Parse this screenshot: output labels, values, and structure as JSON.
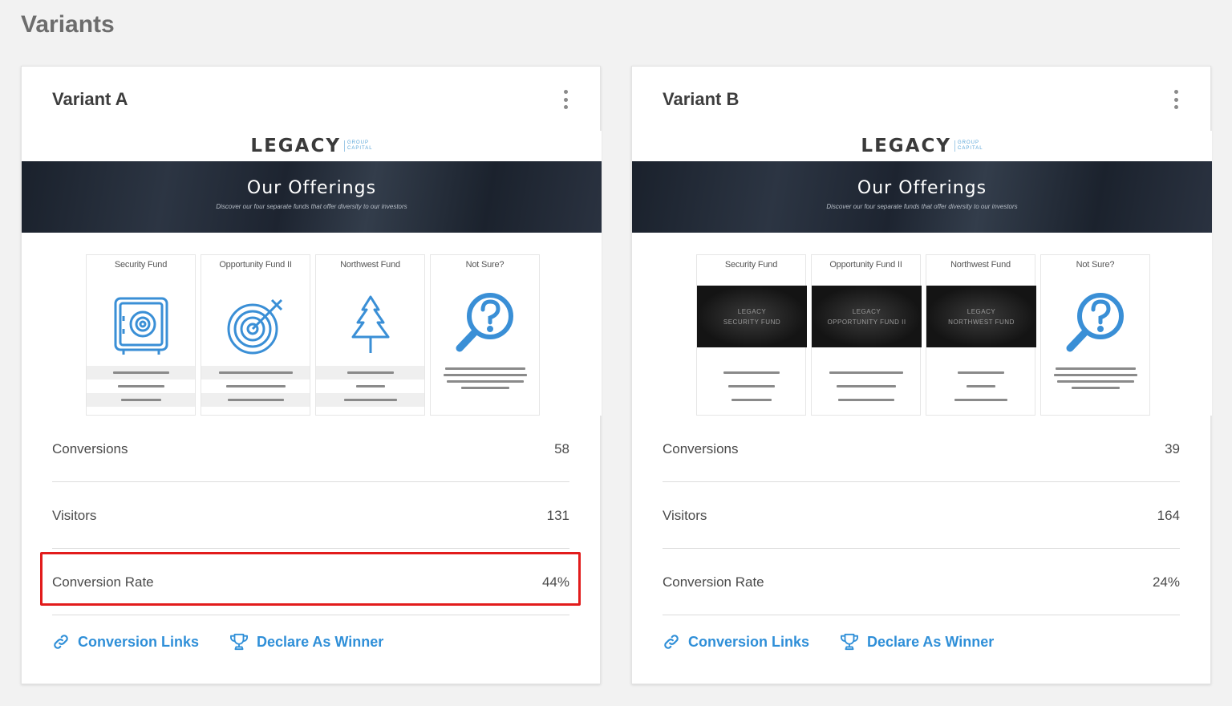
{
  "page": {
    "title": "Variants"
  },
  "variants": [
    {
      "name": "Variant A",
      "preview": {
        "logo": "LEGACY",
        "logo_sub": [
          "GROUP",
          "CAPITAL"
        ],
        "hero_title": "Our Offerings",
        "hero_subtitle": "Discover our four separate funds that offer diversity to our investors",
        "offerings": [
          {
            "name": "Security Fund",
            "icon": "safe-icon"
          },
          {
            "name": "Opportunity Fund II",
            "icon": "target-icon"
          },
          {
            "name": "Northwest Fund",
            "icon": "tree-icon"
          },
          {
            "name": "Not Sure?",
            "icon": "question-magnifier-icon"
          }
        ]
      },
      "stats": {
        "conversions_label": "Conversions",
        "conversions": "58",
        "visitors_label": "Visitors",
        "visitors": "131",
        "rate_label": "Conversion Rate",
        "rate": "44%"
      },
      "actions": {
        "links_label": "Conversion Links",
        "winner_label": "Declare As Winner"
      }
    },
    {
      "name": "Variant B",
      "preview": {
        "logo": "LEGACY",
        "logo_sub": [
          "GROUP",
          "CAPITAL"
        ],
        "hero_title": "Our Offerings",
        "hero_subtitle": "Discover our four separate funds that offer diversity to our investors",
        "offerings": [
          {
            "name": "Security Fund",
            "thumb": [
              "LEGACY",
              "SECURITY FUND"
            ]
          },
          {
            "name": "Opportunity Fund II",
            "thumb": [
              "LEGACY",
              "OPPORTUNITY FUND II"
            ]
          },
          {
            "name": "Northwest Fund",
            "thumb": [
              "LEGACY",
              "NORTHWEST FUND"
            ]
          },
          {
            "name": "Not Sure?",
            "icon": "question-magnifier-icon"
          }
        ]
      },
      "stats": {
        "conversions_label": "Conversions",
        "conversions": "39",
        "visitors_label": "Visitors",
        "visitors": "164",
        "rate_label": "Conversion Rate",
        "rate": "24%"
      },
      "actions": {
        "links_label": "Conversion Links",
        "winner_label": "Declare As Winner"
      }
    }
  ],
  "colors": {
    "accent": "#2f8fd8",
    "highlight": "#e21c1c",
    "icon_blue": "#3a8fd6"
  }
}
